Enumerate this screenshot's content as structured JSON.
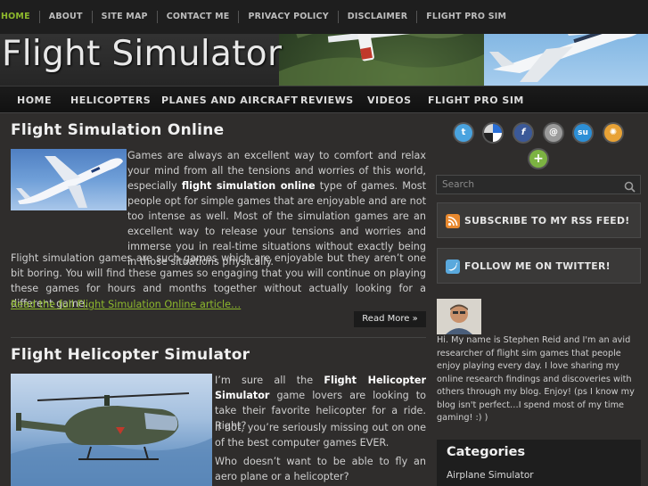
{
  "top_nav": {
    "items": [
      "HOME",
      "ABOUT",
      "SITE MAP",
      "CONTACT ME",
      "PRIVACY POLICY",
      "DISCLAIMER",
      "FLIGHT PRO SIM"
    ]
  },
  "header": {
    "site_title": "Flight Simulator"
  },
  "main_nav": {
    "items": [
      "HOME",
      "HELICOPTERS",
      "PLANES AND AIRCRAFT",
      "REVIEWS",
      "VIDEOS",
      "FLIGHT PRO SIM"
    ]
  },
  "posts": [
    {
      "title": "Flight Simulation Online",
      "p1_parts": [
        "Games are always an excellent way to comfort and relax your mind from all the tensions and worries of this world, especially ",
        "flight simulation online",
        " type of games.  Most people opt for simple games that are enjoyable and are not too intense as well.  Most of the simulation games are an excellent way to release your tensions and worries and immerse you in real-time situations without exactly being in those situations physically."
      ],
      "p2": "Flight simulation games are such games which are enjoyable but they aren’t one bit boring.  You will find these games so engaging that you will continue on playing these games for hours and months together without actually looking for a different game.",
      "read_full": "Read the full Flight Simulation Online article…",
      "read_more": "Read More »"
    },
    {
      "title": "Flight Helicopter Simulator",
      "p1_parts": [
        "I’m sure all the ",
        "Flight Helicopter Simulator",
        " game lovers are looking to take their favorite helicopter for a ride.  Right?"
      ],
      "p2": "If not, you’re seriously missing out on one of the best computer games EVER.",
      "p3": "Who doesn’t want to be able to fly an aero plane or a helicopter?"
    }
  ],
  "sidebar": {
    "social_icons": [
      {
        "name": "twitter-icon",
        "glyph": "t",
        "color": "#4aa3df"
      },
      {
        "name": "delicious-icon",
        "glyph": "",
        "color": "#dddddd"
      },
      {
        "name": "facebook-icon",
        "glyph": "f",
        "color": "#3b5998"
      },
      {
        "name": "technorati-icon",
        "glyph": "@",
        "color": "#9a9a9a"
      },
      {
        "name": "stumbleupon-icon",
        "glyph": "su",
        "color": "#2d8fd6"
      },
      {
        "name": "mixx-icon",
        "glyph": "✺",
        "color": "#e8a236"
      },
      {
        "name": "share-plus-icon",
        "glyph": "+",
        "color": "#7cb342"
      }
    ],
    "search_placeholder": "Search",
    "rss_label": "SUBSCRIBE TO MY RSS FEED!",
    "twitter_label": "FOLLOW ME ON TWITTER!",
    "bio": "Hi. My name is Stephen Reid and I'm an avid researcher of flight sim games that people enjoy playing every day. I love sharing my online research findings and discoveries with others through my blog. Enjoy! (ps I know my blog isn't perfect…I spend most of my time gaming! :) )",
    "categories_title": "Categories",
    "categories": [
      "Airplane Simulator"
    ]
  },
  "colors": {
    "accent_green": "#8db82c",
    "background": "#2f2d2c",
    "nav_bg": "#111111"
  }
}
